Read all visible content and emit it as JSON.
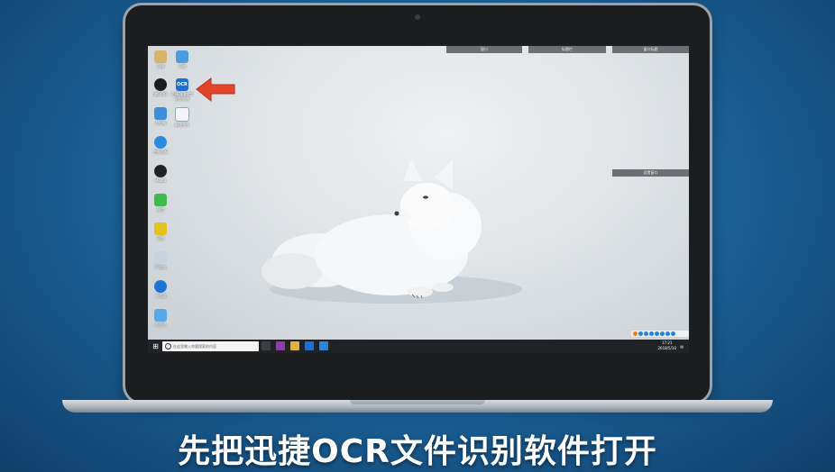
{
  "caption": "先把迅捷OCR文件识别软件打开",
  "desktop": {
    "icons": [
      {
        "id": "icon-1",
        "label": "迅捷"
      },
      {
        "id": "icon-2",
        "label": "网络"
      },
      {
        "id": "icon-qq",
        "label": "腾讯QQ"
      },
      {
        "id": "icon-ocr",
        "label": "迅捷OCR文字识别软件"
      },
      {
        "id": "icon-3",
        "label": "此电脑"
      },
      {
        "id": "icon-4",
        "label": "新建文件"
      },
      {
        "id": "icon-5",
        "label": "控制面板"
      },
      {
        "id": "icon-6",
        "label": "Media"
      },
      {
        "id": "icon-7",
        "label": "微信"
      },
      {
        "id": "icon-8",
        "label": "迅雷"
      },
      {
        "id": "icon-9",
        "label": "回收站"
      },
      {
        "id": "icon-10",
        "label": "浏览器"
      },
      {
        "id": "icon-11",
        "label": "任务栏"
      }
    ],
    "top_bars": [
      "窗口",
      "标题栏",
      "窗口标题"
    ],
    "side_bar": "设置窗口"
  },
  "taskbar": {
    "search_placeholder": "在这里输入你要搜索的内容",
    "clock_time": "17:21",
    "clock_date": "2018/5/10"
  },
  "colors": {
    "background": "#1a5e93",
    "arrow": "#e2452a",
    "ocr_icon": "#1f6fd1"
  }
}
